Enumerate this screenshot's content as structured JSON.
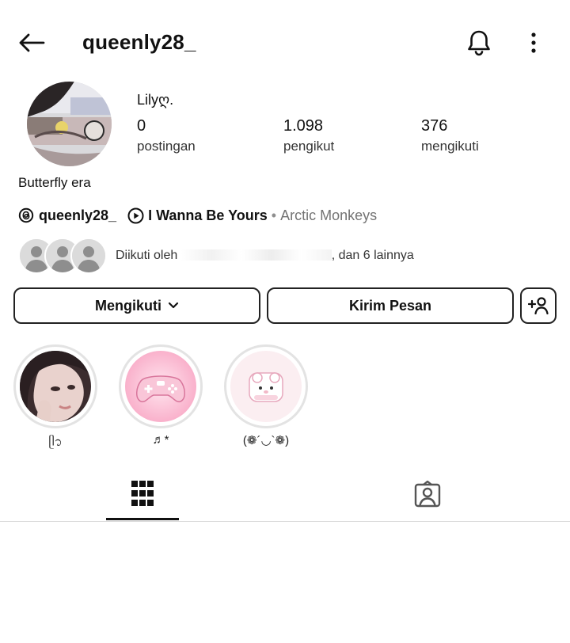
{
  "header": {
    "username": "queenly28_",
    "back_icon": "arrow-left-icon",
    "notification_icon": "bell-icon",
    "more_icon": "more-vertical-icon"
  },
  "profile": {
    "display_name": "Lilyღ.",
    "stats": {
      "posts": {
        "count": "0",
        "label": "postingan"
      },
      "followers": {
        "count": "1.098",
        "label": "pengikut"
      },
      "following": {
        "count": "376",
        "label": "mengikuti"
      }
    },
    "bio": "Butterfly era",
    "threads_handle": "queenly28_",
    "music": {
      "title": "I Wanna Be Yours",
      "separator": "•",
      "artist": "Arctic Monkeys"
    },
    "followed_by": {
      "prefix": "Diikuti oleh",
      "suffix": ", dan 6 lainnya"
    }
  },
  "actions": {
    "following_label": "Mengikuti",
    "message_label": "Kirim Pesan",
    "add_person_icon": "add-person-icon"
  },
  "highlights": [
    {
      "label": "ᥫ᭡"
    },
    {
      "label": "♬*"
    },
    {
      "label": "(❁´◡`❁)"
    }
  ],
  "tabs": [
    {
      "name": "posts-grid",
      "icon": "grid-icon",
      "active": true
    },
    {
      "name": "tagged",
      "icon": "tagged-person-icon",
      "active": false
    }
  ],
  "colors": {
    "text_primary": "#111111",
    "text_secondary": "#737373",
    "border": "#222222",
    "divider": "#dbdbdb"
  }
}
